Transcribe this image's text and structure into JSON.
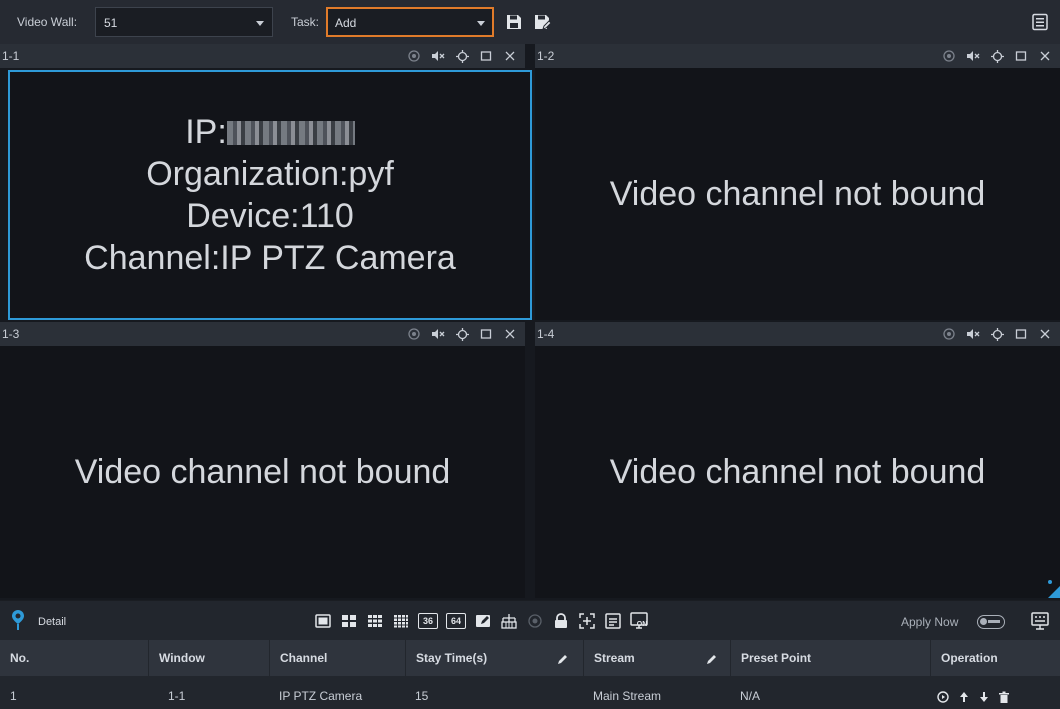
{
  "toolbar": {
    "video_wall_label": "Video Wall:",
    "video_wall_value": "51",
    "task_label": "Task:",
    "task_value": "Add"
  },
  "panes": [
    {
      "id": "1-1",
      "selected": true,
      "lines": [
        "IP:",
        "Organization:pyf",
        "Device:110",
        "Channel:IP PTZ Camera"
      ]
    },
    {
      "id": "1-2",
      "selected": false,
      "message": "Video channel not bound"
    },
    {
      "id": "1-3",
      "selected": false,
      "message": "Video channel not bound"
    },
    {
      "id": "1-4",
      "selected": false,
      "message": "Video channel not bound"
    }
  ],
  "bottom": {
    "detail_label": "Detail",
    "apply_now_label": "Apply Now",
    "layout_36": "36",
    "layout_64": "64",
    "on_badge": "ON",
    "columns": [
      "No.",
      "Window",
      "Channel",
      "Stay Time(s)",
      "Stream",
      "Preset Point",
      "Operation"
    ],
    "rows": [
      {
        "no": "1",
        "window": "1-1",
        "channel": "IP PTZ Camera",
        "stay_time": "15",
        "stream": "Main Stream",
        "preset_point": "N/A"
      }
    ]
  },
  "colors": {
    "accent_blue": "#2e9ad8",
    "focus_orange": "#e07b2a"
  }
}
